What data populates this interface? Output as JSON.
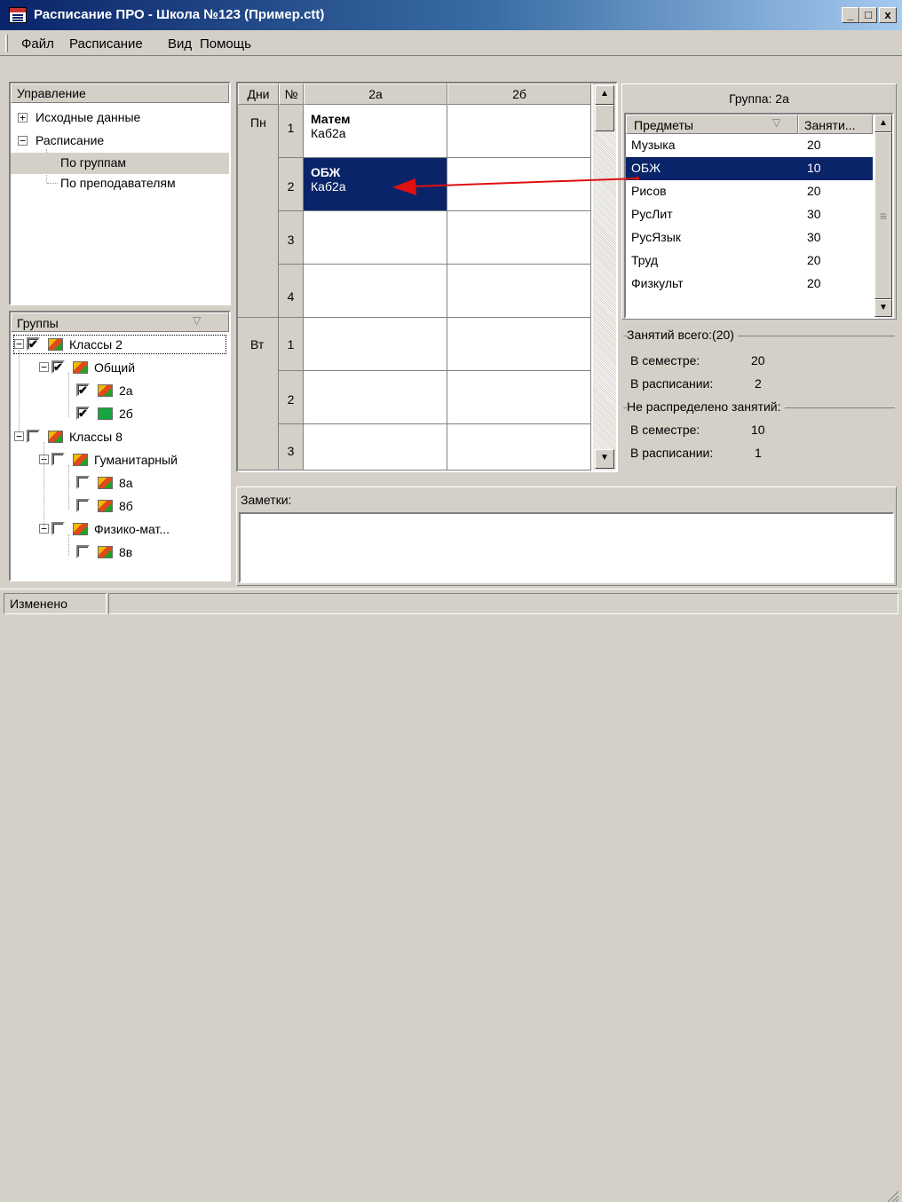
{
  "window": {
    "title": "Расписание ПРО - Школа №123 (Пример.ctt)",
    "minimize_glyph": "_",
    "maximize_glyph": "□",
    "close_glyph": "x"
  },
  "menu": [
    "Файл",
    "Расписание",
    "Вид",
    "Помощь"
  ],
  "nav": {
    "header": "Управление",
    "items": [
      {
        "label": "Исходные данные",
        "expander": "+"
      },
      {
        "label": "Расписание",
        "expander": "−"
      },
      {
        "label": "По группам"
      },
      {
        "label": "По преподавателям"
      }
    ]
  },
  "groups": {
    "header": "Группы",
    "sort_glyph": "▽",
    "nodes": [
      {
        "label": "Классы 2",
        "checked": "✔",
        "expander": "−"
      },
      {
        "label": "Общий",
        "checked": "✔",
        "expander": "−"
      },
      {
        "label": "2а",
        "checked": "✔"
      },
      {
        "label": "2б",
        "checked": "✔"
      },
      {
        "label": "Классы 8",
        "checked": "",
        "expander": "−"
      },
      {
        "label": "Гуманитарный",
        "checked": "",
        "expander": "−"
      },
      {
        "label": "8а",
        "checked": ""
      },
      {
        "label": "8б",
        "checked": ""
      },
      {
        "label": "Физико-мат...",
        "checked": "",
        "expander": "−"
      },
      {
        "label": "8в",
        "checked": ""
      }
    ]
  },
  "schedule": {
    "headers": {
      "days": "Дни",
      "num": "№",
      "col1": "2а",
      "col2": "2б"
    },
    "days": [
      "Пн",
      "Вт"
    ],
    "rows": [
      {
        "num": "1",
        "subject": "Матем",
        "room": "Каб2а"
      },
      {
        "num": "2",
        "subject": "ОБЖ",
        "room": "Каб2а"
      },
      {
        "num": "3",
        "subject": "",
        "room": ""
      },
      {
        "num": "4",
        "subject": "",
        "room": ""
      },
      {
        "num": "1",
        "subject": "",
        "room": ""
      },
      {
        "num": "2",
        "subject": "",
        "room": ""
      },
      {
        "num": "3",
        "subject": "",
        "room": ""
      }
    ]
  },
  "group_panel": {
    "title": "Группа: 2а",
    "col_subject": "Предметы",
    "col_lessons": "Заняти...",
    "subjects": [
      {
        "name": "Музыка",
        "count": "20"
      },
      {
        "name": "ОБЖ",
        "count": "10"
      },
      {
        "name": "Рисов",
        "count": "20"
      },
      {
        "name": "РусЛит",
        "count": "30"
      },
      {
        "name": "РусЯзык",
        "count": "30"
      },
      {
        "name": "Труд",
        "count": "20"
      },
      {
        "name": "Физкульт",
        "count": "20"
      }
    ]
  },
  "stats": {
    "total_title": "Занятий всего:",
    "total_value": "(20)",
    "semester_label": "В семестре:",
    "semester_value": "20",
    "scheduled_label": "В расписании:",
    "scheduled_value": "2",
    "unassigned_title": "Не распределено занятий:",
    "un_semester_label": "В семестре:",
    "un_semester_value": "10",
    "un_scheduled_label": "В расписании:",
    "un_scheduled_value": "1"
  },
  "notes": {
    "label": "Заметки:",
    "value": ""
  },
  "status": {
    "text": "Изменено"
  },
  "colors": {
    "selection": "#0a246a",
    "arrow": "#e01010",
    "face": "#d4d0c8"
  },
  "icons": {
    "app": "app-icon",
    "group": "group-icon",
    "scroll_up": "▲",
    "scroll_down": "▼",
    "scroll_grip": "≡",
    "sort": "▽"
  }
}
